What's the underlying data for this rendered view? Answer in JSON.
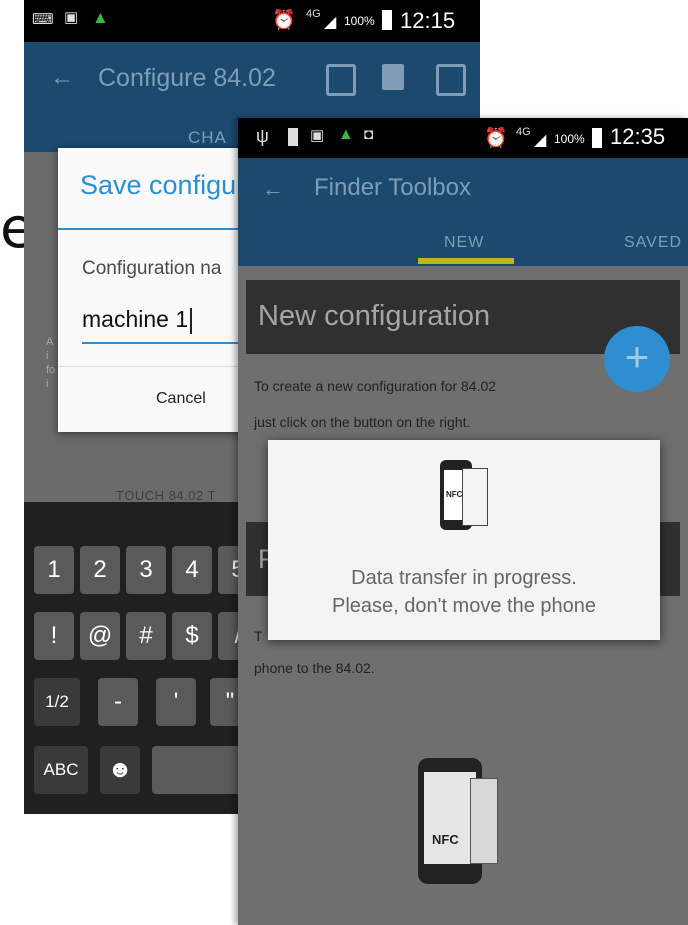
{
  "back_screen": {
    "status": {
      "battery": "100%",
      "time": "12:15",
      "network": "4G"
    },
    "toolbar": {
      "title": "Configure 84.02"
    },
    "tab_partial": "CHA",
    "dialog": {
      "title": "Save configu",
      "label": "Configuration na",
      "input_value": "machine 1",
      "cancel_label": "Cancel"
    },
    "hint_text": "TOUCH 84.02 T",
    "left_edge_letters": [
      "A",
      "i",
      "fo",
      "i"
    ],
    "keyboard": {
      "row1": [
        "1",
        "2",
        "3",
        "4",
        "5"
      ],
      "row2": [
        "!",
        "@",
        "#",
        "$",
        "/"
      ],
      "row3": [
        "1/2",
        "-",
        "'",
        "\""
      ],
      "row4": [
        "ABC"
      ]
    }
  },
  "front_screen": {
    "status": {
      "battery": "100%",
      "time": "12:35",
      "network": "4G"
    },
    "toolbar": {
      "title": "Finder Toolbox"
    },
    "tabs": [
      "NEW",
      "SAVED"
    ],
    "new_card_title": "New configuration",
    "fab_label": "+",
    "instructions": [
      "To create a new configuration for 84.02",
      "just click on the button on the right."
    ],
    "second_card_partial": "F",
    "partial_text_t": "T",
    "phone_text": "phone to the 84.02.",
    "popup_lines": [
      "Data transfer in progress.",
      "Please, don't move the phone"
    ],
    "nfc_label": "NFC"
  },
  "colors": {
    "appbar": "#1b4a6e",
    "accent": "#2c8fcf",
    "tab_indicator": "#c2b21e"
  },
  "icons": [
    "back-arrow-icon",
    "copy-icon",
    "paste-icon",
    "save-icon",
    "alarm-icon",
    "signal-icon",
    "battery-icon",
    "nfc-phone-icon",
    "add-icon"
  ],
  "fragments": {
    "big_e": "e"
  }
}
